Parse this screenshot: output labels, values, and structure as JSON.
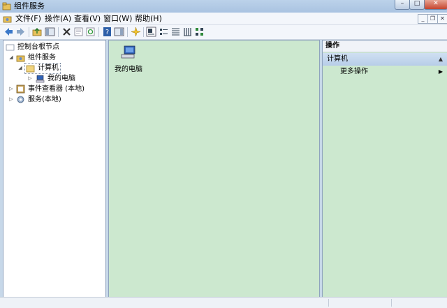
{
  "window": {
    "title": "组件服务"
  },
  "menu": {
    "items": [
      "文件(F)",
      "操作(A)",
      "查看(V)",
      "窗口(W)",
      "帮助(H)"
    ]
  },
  "toolbar": {
    "buttons": [
      "back-icon",
      "forward-icon",
      "up-folder-icon",
      "show-tree-icon",
      "delete-icon",
      "properties-icon",
      "refresh-icon",
      "help-icon",
      "show-action-pane-icon",
      "new-object-icon",
      "large-icons-view-icon",
      "small-icons-view-icon",
      "list-view-icon",
      "detail-view-icon",
      "configure-icon"
    ]
  },
  "tree": {
    "nodes": [
      {
        "label": "控制台根节点",
        "icon": "folder-icon"
      },
      {
        "label": "组件服务",
        "icon": "component-services-icon"
      },
      {
        "label": "计算机",
        "icon": "folder-icon"
      },
      {
        "label": "我的电脑",
        "icon": "computer-icon"
      },
      {
        "label": "事件查看器 (本地)",
        "icon": "event-viewer-icon"
      },
      {
        "label": "服务(本地)",
        "icon": "services-gear-icon"
      }
    ]
  },
  "result": {
    "items": [
      {
        "label": "我的电脑",
        "icon": "computer-icon"
      }
    ]
  },
  "actions": {
    "header": "操作",
    "section": "计算机",
    "items": [
      "更多操作"
    ]
  },
  "colors": {
    "pane_green": "#cce8cf",
    "title_blue": "#a9c3e1"
  }
}
